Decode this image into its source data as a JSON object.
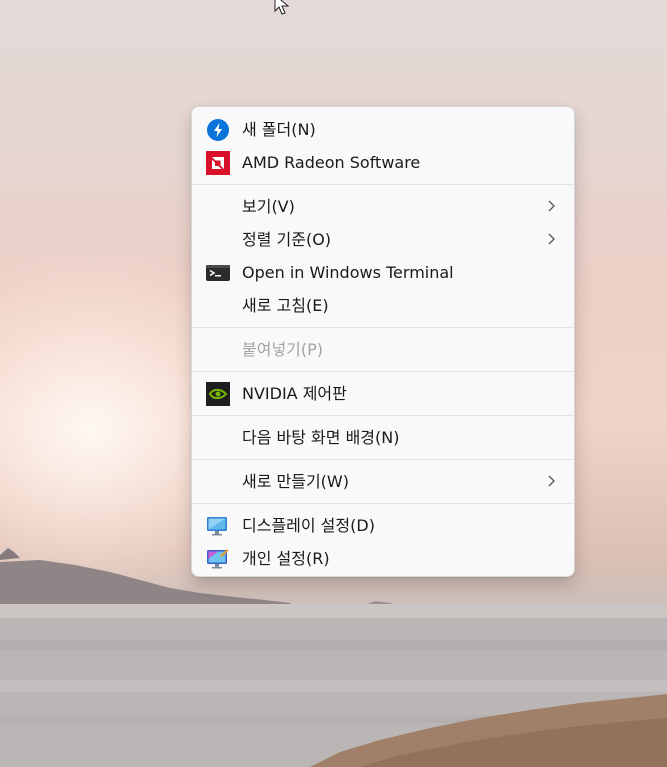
{
  "context_menu": {
    "items": [
      {
        "label": "새 폴더(N)",
        "icon": "power-automate-icon"
      },
      {
        "label": "AMD Radeon Software",
        "icon": "amd-radeon-icon"
      },
      {
        "label": "보기(V)",
        "submenu": true
      },
      {
        "label": "정렬 기준(O)",
        "submenu": true
      },
      {
        "label": "Open in Windows Terminal",
        "icon": "terminal-icon"
      },
      {
        "label": "새로 고침(E)"
      },
      {
        "label": "붙여넣기(P)",
        "disabled": true
      },
      {
        "label": "NVIDIA 제어판",
        "icon": "nvidia-icon"
      },
      {
        "label": "다음 바탕 화면 배경(N)"
      },
      {
        "label": "새로 만들기(W)",
        "submenu": true
      },
      {
        "label": "디스플레이 설정(D)",
        "icon": "display-settings-icon"
      },
      {
        "label": "개인 설정(R)",
        "icon": "personalize-icon"
      }
    ]
  },
  "colors": {
    "menu_background": "#f9f9f9",
    "amd_red": "#d8102a",
    "nvidia_green": "#76b900",
    "accent_blue": "#0a73d9"
  }
}
